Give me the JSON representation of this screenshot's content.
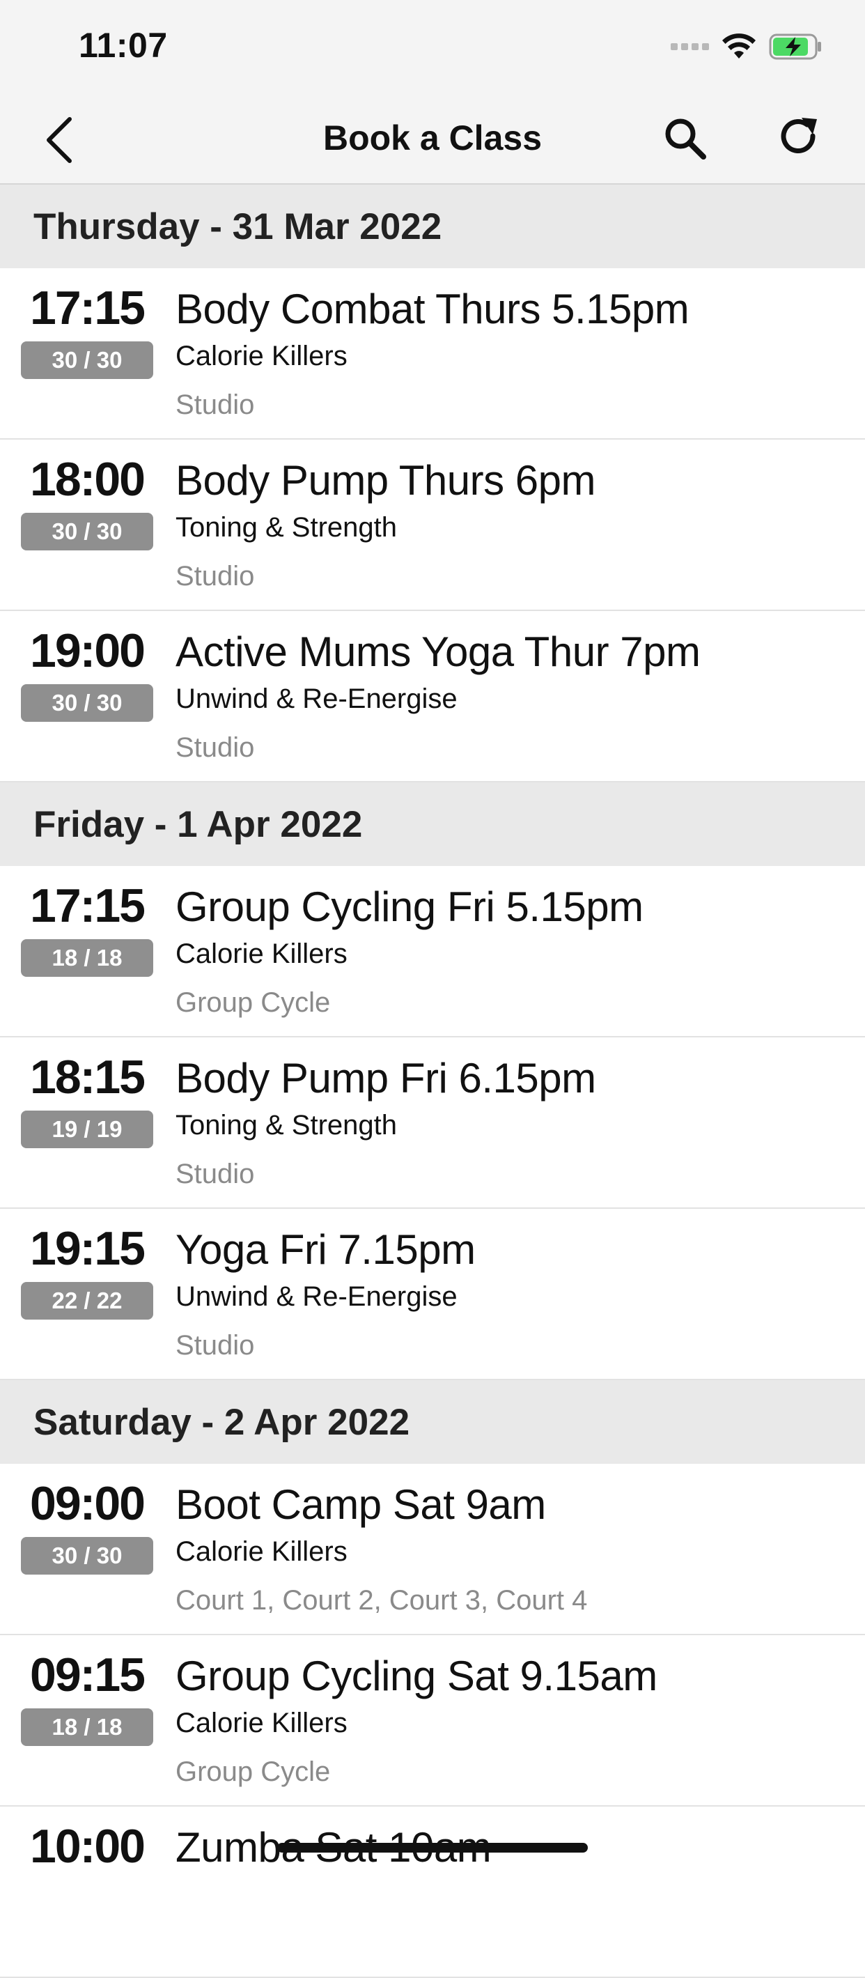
{
  "status_bar": {
    "time": "11:07"
  },
  "nav": {
    "title": "Book a Class"
  },
  "sections": [
    {
      "header": "Thursday - 31 Mar 2022",
      "classes": [
        {
          "time": "17:15",
          "spaces": "30 / 30",
          "name": "Body Combat Thurs 5.15pm",
          "category": "Calorie Killers",
          "location": "Studio"
        },
        {
          "time": "18:00",
          "spaces": "30 / 30",
          "name": "Body Pump Thurs 6pm",
          "category": "Toning & Strength",
          "location": "Studio"
        },
        {
          "time": "19:00",
          "spaces": "30 / 30",
          "name": "Active Mums Yoga Thur 7pm",
          "category": "Unwind & Re-Energise",
          "location": "Studio"
        }
      ]
    },
    {
      "header": "Friday - 1 Apr 2022",
      "classes": [
        {
          "time": "17:15",
          "spaces": "18 / 18",
          "name": "Group Cycling Fri 5.15pm",
          "category": "Calorie Killers",
          "location": "Group Cycle"
        },
        {
          "time": "18:15",
          "spaces": "19 / 19",
          "name": "Body Pump Fri 6.15pm",
          "category": "Toning & Strength",
          "location": "Studio"
        },
        {
          "time": "19:15",
          "spaces": "22 / 22",
          "name": "Yoga Fri 7.15pm",
          "category": "Unwind & Re-Energise",
          "location": "Studio"
        }
      ]
    },
    {
      "header": "Saturday - 2 Apr 2022",
      "classes": [
        {
          "time": "09:00",
          "spaces": "30 / 30",
          "name": "Boot Camp Sat 9am",
          "category": "Calorie Killers",
          "location": "Court 1, Court 2, Court 3, Court 4"
        },
        {
          "time": "09:15",
          "spaces": "18 / 18",
          "name": "Group Cycling Sat 9.15am",
          "category": "Calorie Killers",
          "location": "Group Cycle"
        },
        {
          "time": "10:00",
          "spaces": "",
          "name": "Zumba Sat 10am",
          "category": "",
          "location": ""
        }
      ]
    }
  ],
  "colors": {
    "badge": "#8f8f8f",
    "section_header_bg": "#e9e9e9",
    "nav_bg": "#f4f4f4",
    "battery_fill": "#4cd964"
  }
}
